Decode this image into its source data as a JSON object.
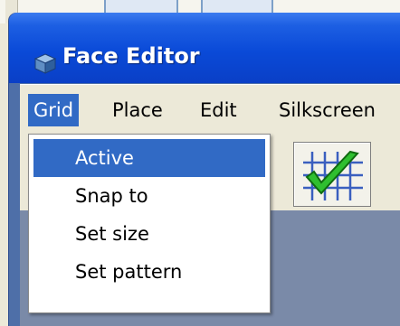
{
  "window": {
    "title": "Face Editor",
    "app_icon": "cube-app-icon"
  },
  "menubar": {
    "items": [
      {
        "label": "Grid",
        "active": true
      },
      {
        "label": "Place"
      },
      {
        "label": "Edit"
      },
      {
        "label": "Silkscreen"
      }
    ]
  },
  "grid_menu": {
    "items": [
      {
        "label": "Active",
        "highlighted": true
      },
      {
        "label": "Snap to"
      },
      {
        "label": "Set size"
      },
      {
        "label": "Set pattern"
      }
    ]
  },
  "toolbar": {
    "buttons": [
      {
        "icon": "grid-snap-icon"
      },
      {
        "icon": "grid-active-check-icon"
      }
    ]
  },
  "colors": {
    "titlebar": "#0a4ad8",
    "menu_highlight": "#316ac5",
    "check_green": "#2fbf2f",
    "grid_blue": "#3a5fbf"
  }
}
